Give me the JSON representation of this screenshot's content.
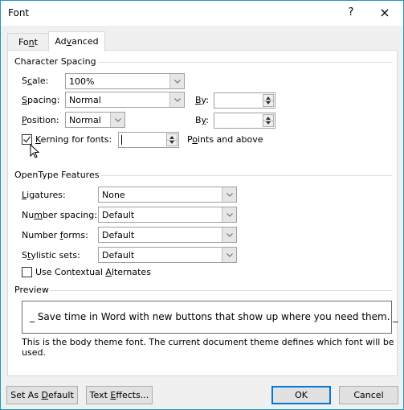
{
  "window": {
    "title": "Font",
    "help_label": "?",
    "close_label": "×"
  },
  "tabs": [
    {
      "label_pre": "Fo",
      "label_ul": "n",
      "label_post": "t",
      "active": false
    },
    {
      "label_pre": "Ad",
      "label_ul": "v",
      "label_post": "anced",
      "active": true
    }
  ],
  "character_spacing": {
    "title": "Character Spacing",
    "scale": {
      "label_pre": "S",
      "label_ul": "c",
      "label_post": "ale:",
      "value": "100%"
    },
    "spacing": {
      "label_pre": "",
      "label_ul": "S",
      "label_post": "pacing:",
      "value": "Normal",
      "by_pre": "",
      "by_ul": "B",
      "by_post": "y:",
      "by_value": ""
    },
    "position": {
      "label_pre": "",
      "label_ul": "P",
      "label_post": "osition:",
      "value": "Normal",
      "by_pre": "B",
      "by_ul": "y",
      "by_post": ":",
      "by_value": ""
    },
    "kerning": {
      "checked": true,
      "label_pre": "",
      "label_ul": "K",
      "label_post": "erning for fonts:",
      "value": "",
      "suffix_pre": "P",
      "suffix_ul": "o",
      "suffix_post": "ints and above"
    }
  },
  "opentype": {
    "title": "OpenType Features",
    "ligatures": {
      "label_pre": "",
      "label_ul": "L",
      "label_post": "igatures:",
      "value": "None"
    },
    "number_spacing": {
      "label_pre": "Nu",
      "label_ul": "m",
      "label_post": "ber spacing:",
      "value": "Default"
    },
    "number_forms": {
      "label_pre": "Number ",
      "label_ul": "f",
      "label_post": "orms:",
      "value": "Default"
    },
    "stylistic_sets": {
      "label_pre": "S",
      "label_ul": "t",
      "label_post": "ylistic sets:",
      "value": "Default"
    },
    "contextual": {
      "checked": false,
      "label_pre": "Use Contextual ",
      "label_ul": "A",
      "label_post": "lternates"
    }
  },
  "preview": {
    "title": "Preview",
    "text": "_ Save time in Word with new buttons that show up where you need them.  _",
    "note": "This is the body theme font. The current document theme defines which font will be used."
  },
  "buttons": {
    "set_default": {
      "pre": "Set As ",
      "ul": "D",
      "post": "efault"
    },
    "text_effects": {
      "pre": "Text ",
      "ul": "E",
      "post": "ffects..."
    },
    "ok": "OK",
    "cancel": "Cancel"
  }
}
